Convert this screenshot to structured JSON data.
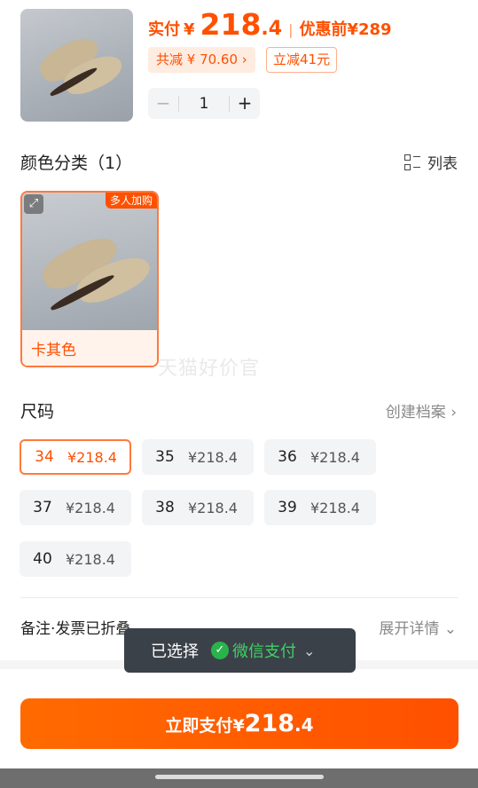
{
  "product": {
    "price_label": "实付",
    "currency": "¥",
    "price_int": "218",
    "price_dec": ".4",
    "separator": "|",
    "original_label": "优惠前",
    "original_price": "¥289",
    "total_discount": "共减 ¥ 70.60 ›",
    "instant_discount": "立减41元",
    "quantity": "1",
    "minus": "−",
    "plus": "+"
  },
  "color_section": {
    "title": "颜色分类（1）",
    "list_toggle": "列表",
    "options": [
      {
        "label": "卡其色",
        "badge": "多人加购",
        "selected": true
      }
    ],
    "watermark": "天猫好价官"
  },
  "size_section": {
    "title": "尺码",
    "archive_link": "创建档案 ›",
    "sizes": [
      {
        "size": "34",
        "price": "¥218.4",
        "selected": true
      },
      {
        "size": "35",
        "price": "¥218.4",
        "selected": false
      },
      {
        "size": "36",
        "price": "¥218.4",
        "selected": false
      },
      {
        "size": "37",
        "price": "¥218.4",
        "selected": false
      },
      {
        "size": "38",
        "price": "¥218.4",
        "selected": false
      },
      {
        "size": "39",
        "price": "¥218.4",
        "selected": false
      },
      {
        "size": "40",
        "price": "¥218.4",
        "selected": false
      }
    ]
  },
  "remarks": {
    "label": "备注·发票已折叠",
    "expand": "展开详情 ⌄"
  },
  "toast": {
    "label": "已选择",
    "method": "微信支付",
    "chevron": "⌄"
  },
  "pay": {
    "label": "立即支付",
    "currency": "¥",
    "int": "218",
    "dec": ".4"
  },
  "colors": {
    "accent": "#ff5000",
    "wechat_green": "#2ab34b"
  }
}
